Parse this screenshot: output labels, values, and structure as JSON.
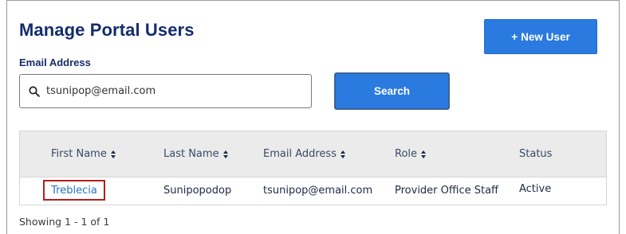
{
  "page": {
    "title": "Manage Portal Users",
    "new_user_label": "New User",
    "new_user_icon": "+"
  },
  "search": {
    "label": "Email Address",
    "value": "tsunipop@email.com",
    "placeholder": "",
    "button_label": "Search"
  },
  "table": {
    "columns": [
      "First Name",
      "Last Name",
      "Email Address",
      "Role",
      "Status"
    ],
    "rows": [
      {
        "first_name": "Treblecia",
        "last_name": "Sunipopodop",
        "email": "tsunipop@email.com",
        "role": "Provider Office Staff",
        "status": "Active"
      }
    ]
  },
  "pagination": {
    "summary": "Showing 1 - 1 of 1"
  },
  "colors": {
    "primary": "#2a7ae0",
    "title": "#142d6b",
    "link": "#2a72c6",
    "highlight_border": "#b51e1e"
  }
}
